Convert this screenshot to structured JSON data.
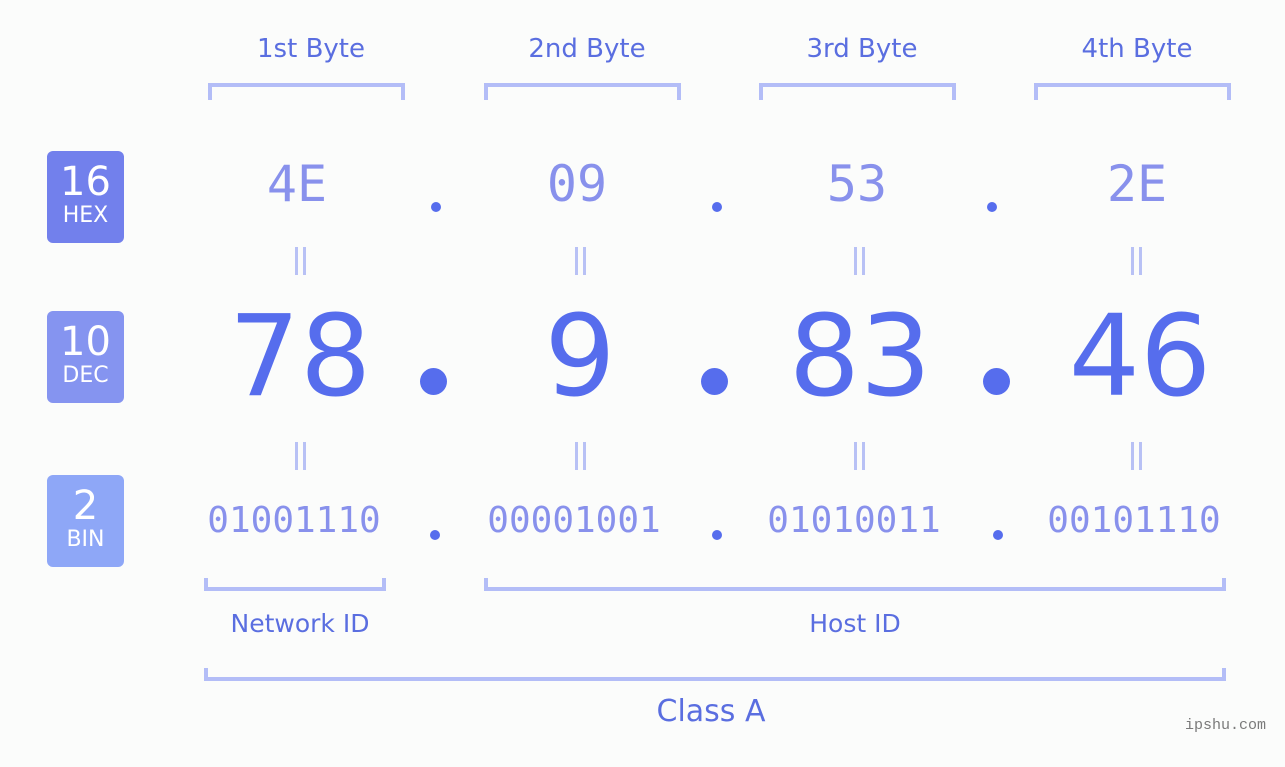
{
  "bases": [
    {
      "radix": "16",
      "label": "HEX",
      "color": "#7280ec"
    },
    {
      "radix": "10",
      "label": "DEC",
      "color": "#8594f0"
    },
    {
      "radix": "2",
      "label": "BIN",
      "color": "#8ea7f7"
    }
  ],
  "bytes": [
    {
      "header": "1st Byte",
      "hex": "4E",
      "dec": "78",
      "bin": "01001110"
    },
    {
      "header": "2nd Byte",
      "hex": "09",
      "dec": "9",
      "bin": "00001001"
    },
    {
      "header": "3rd Byte",
      "hex": "53",
      "dec": "83",
      "bin": "01010011"
    },
    {
      "header": "4th Byte",
      "hex": "2E",
      "dec": "46",
      "bin": "00101110"
    }
  ],
  "separator": ".",
  "network_id_label": "Network ID",
  "host_id_label": "Host ID",
  "class_label": "Class A",
  "watermark": "ipshu.com"
}
